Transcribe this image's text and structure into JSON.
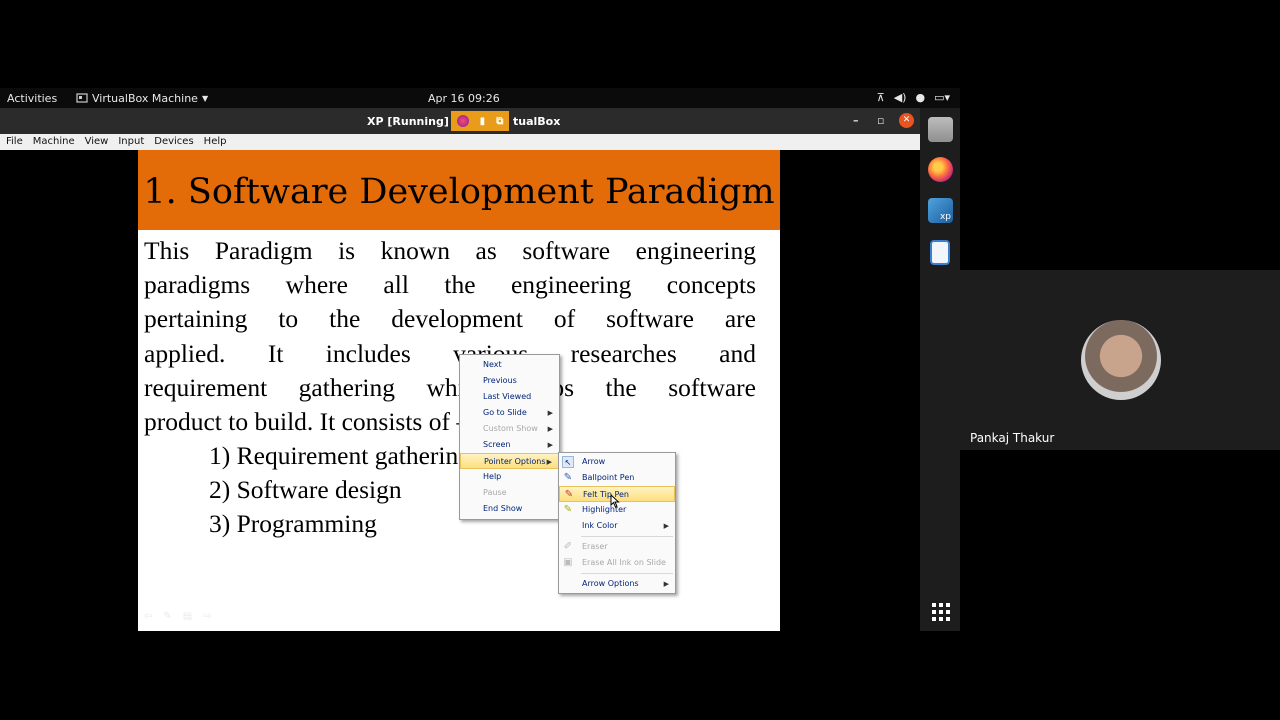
{
  "topbar": {
    "activities": "Activities",
    "app_name": "VirtualBox Machine",
    "clock": "Apr 16  09:26"
  },
  "window": {
    "title": "XP [Running] - Oracle VM VirtualBox",
    "title_visible_left": "XP [Running] - O",
    "title_visible_right": "tualBox"
  },
  "menubar": [
    "File",
    "Machine",
    "View",
    "Input",
    "Devices",
    "Help"
  ],
  "slide": {
    "title": "1. Software Development Paradigm",
    "body_lines": [
      "This Paradigm is known as software engineering",
      "paradigms where all the engineering concepts",
      "pertaining to the development of software are",
      "applied. It includes various researches and",
      "requirement gathering which helps the software",
      "product to build. It consists of –"
    ],
    "list": [
      "1) Requirement gathering",
      "2) Software design",
      "3) Programming"
    ]
  },
  "context_menu": {
    "items": [
      {
        "label": "Next",
        "disabled": false
      },
      {
        "label": "Previous",
        "disabled": false
      },
      {
        "label": "Last Viewed",
        "disabled": false
      },
      {
        "label": "Go to Slide",
        "disabled": false,
        "submenu": true
      },
      {
        "label": "Custom Show",
        "disabled": true,
        "submenu": true
      },
      {
        "label": "Screen",
        "disabled": false,
        "submenu": true
      },
      {
        "label": "Pointer Options",
        "disabled": false,
        "submenu": true,
        "highlighted": true
      },
      {
        "label": "Help",
        "disabled": false
      },
      {
        "label": "Pause",
        "disabled": true
      },
      {
        "label": "End Show",
        "disabled": false
      }
    ]
  },
  "pointer_submenu": {
    "items": [
      {
        "label": "Arrow",
        "icon": "arrow-pointer-icon",
        "disabled": false
      },
      {
        "label": "Ballpoint Pen",
        "icon": "ballpoint-pen-icon",
        "disabled": false
      },
      {
        "label": "Felt Tip Pen",
        "icon": "felt-tip-pen-icon",
        "disabled": false,
        "highlighted": true
      },
      {
        "label": "Highlighter",
        "icon": "highlighter-icon",
        "disabled": false
      },
      {
        "label": "Ink Color",
        "disabled": false,
        "submenu": true
      },
      {
        "label": "Eraser",
        "icon": "eraser-icon",
        "disabled": true
      },
      {
        "label": "Erase All Ink on Slide",
        "icon": "erase-all-icon",
        "disabled": true
      },
      {
        "label": "Arrow Options",
        "disabled": false,
        "submenu": true
      }
    ]
  },
  "participant": {
    "name": "Pankaj Thakur"
  },
  "colors": {
    "slide_header": "#e36c09",
    "menu_highlight": "#fcdf7f",
    "close_button": "#e95420"
  }
}
